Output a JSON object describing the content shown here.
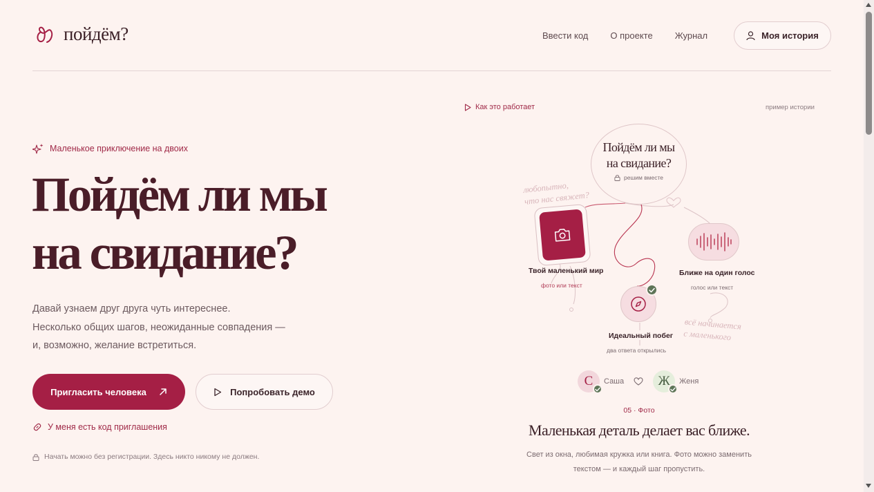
{
  "header": {
    "logo_text": "пойдём?",
    "nav": [
      "Ввести код",
      "О проекте",
      "Журнал"
    ],
    "story_button": "Моя история"
  },
  "hero": {
    "badge": "Маленькое приключение на двоих",
    "title_line1": "Пойдём ли мы",
    "title_line2": "на свидание?",
    "subtitle_lines": [
      "Давай узнаем друг друга чуть интереснее.",
      "Несколько общих шагов, неожиданные совпадения —",
      "и, возможно, желание встретиться."
    ],
    "primary_button": "Пригласить человека",
    "secondary_button": "Попробовать демо",
    "invite_link": "У меня есть код приглашения",
    "footnote": "Начать можно без регистрации. Здесь никто никому не должен."
  },
  "showcase": {
    "how_link": "Как это работает",
    "example_label": "пример истории",
    "main_question_line1": "Пойдём ли мы",
    "main_question_line2": "на свидание?",
    "main_sub": "решим вместе",
    "node_world_label": "Твой маленький мир",
    "node_world_sub": "фото или текст",
    "node_voice_label": "Ближе на один голос",
    "node_voice_sub": "голос или текст",
    "node_escape_label": "Идеальный побег",
    "node_escape_sub": "два ответа открылись",
    "note_curious_line1": "любопытно,",
    "note_curious_line2": "что нас свяжет?",
    "note_start_line1": "всё начинается",
    "note_start_line2": "с маленького",
    "person_a_initial": "С",
    "person_a_name": "Саша",
    "person_b_initial": "Ж",
    "person_b_name": "Женя",
    "step_label": "05 · Фото",
    "step_title": "Маленькая деталь делает вас ближе.",
    "step_desc_line1": "Свет из окна, любимая кружка или книга. Фото можно заменить",
    "step_desc_line2": "текстом — и каждый шаг пропустить."
  },
  "colors": {
    "background": "#fdf3f0",
    "accent": "#a51f45",
    "title": "#4a1d28",
    "success": "#5e7558"
  }
}
